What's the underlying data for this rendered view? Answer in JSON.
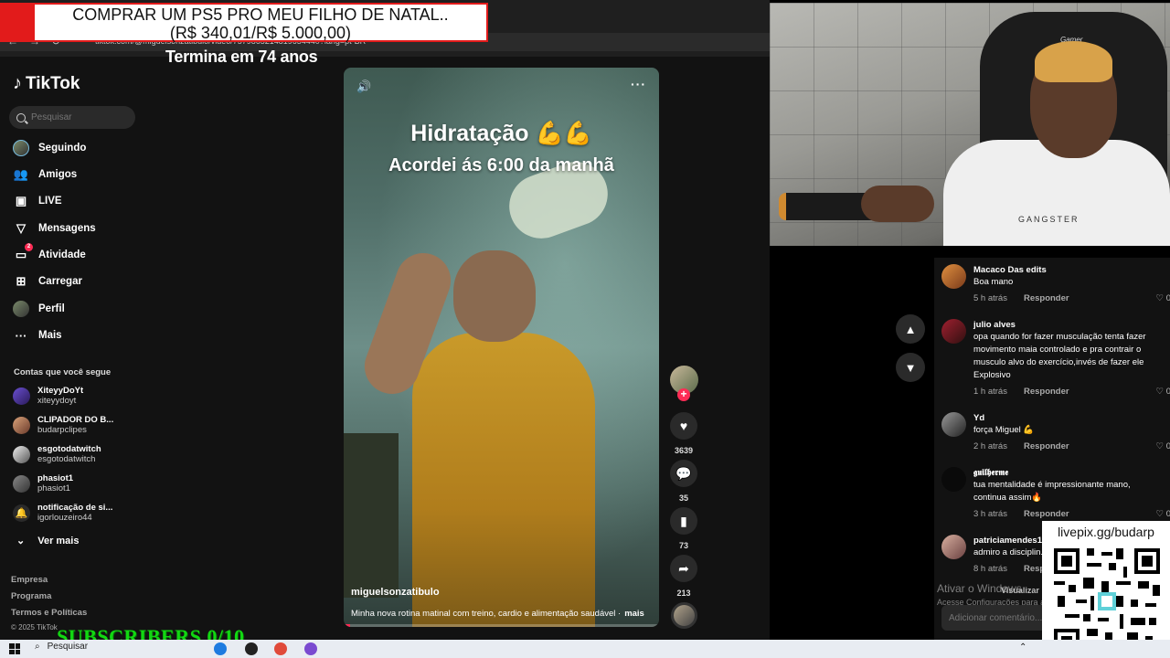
{
  "browser": {
    "url": "tiktok.com/@miguelsonzatibulo/video/7579865214819654440?lang=pt-BR"
  },
  "overlay": {
    "banner_line1": "COMPRAR UM PS5 PRO MEU FILHO DE NATAL..",
    "banner_line2": "(R$ 340,01/R$ 5.000,00)",
    "countdown": "Termina em 74 anos",
    "subscribers": "SUBSCRIBERS 0/10",
    "livepix": "livepix.gg/budarp"
  },
  "sidebar": {
    "logo": "TikTok",
    "search_placeholder": "Pesquisar",
    "nav": [
      {
        "label": "Seguindo",
        "icon": "following-avatar-icon"
      },
      {
        "label": "Amigos",
        "icon": "friends-icon"
      },
      {
        "label": "LIVE",
        "icon": "live-icon"
      },
      {
        "label": "Mensagens",
        "icon": "messages-icon"
      },
      {
        "label": "Atividade",
        "icon": "activity-icon",
        "badge": "2"
      },
      {
        "label": "Carregar",
        "icon": "upload-icon"
      },
      {
        "label": "Perfil",
        "icon": "profile-avatar-icon"
      },
      {
        "label": "Mais",
        "icon": "more-icon"
      }
    ],
    "following_title": "Contas que você segue",
    "accounts": [
      {
        "name": "XiteyyDoYt",
        "handle": "xiteyydoyt"
      },
      {
        "name": "CLIPADOR DO B...",
        "handle": "budarpclipes"
      },
      {
        "name": "esgotodatwitch",
        "handle": "esgotodatwitch"
      },
      {
        "name": "phasiot1",
        "handle": "phasiot1"
      },
      {
        "name": "notificação de si...",
        "handle": "igorlouzeiro44"
      }
    ],
    "see_more": "Ver mais",
    "footer": [
      "Empresa",
      "Programa",
      "Termos e Políticas",
      "© 2025 TikTok"
    ]
  },
  "video": {
    "caption_title": "Hidratação 💪💪",
    "caption_sub": "Acordei ás 6:00 da manhã",
    "author": "miguelsonzatibulo",
    "description": "Minha nova rotina matinal com treino, cardio e alimentação saudável ·",
    "more": "mais",
    "progress": 0.02,
    "likes": "3639",
    "comments": "35",
    "saves": "73",
    "shares": "213"
  },
  "comments": [
    {
      "name": "Macaco Das edits",
      "text": "Boa mano",
      "time": "5 h atrás",
      "reply": "Responder",
      "likes": "0"
    },
    {
      "name": "julio alves",
      "text": "opa quando for fazer musculação tenta fazer movimento maia controlado e pra contrair o musculo alvo do exercício,invés de fazer ele Explosivo",
      "time": "1 h atrás",
      "reply": "Responder",
      "likes": "0"
    },
    {
      "name": "Yd",
      "text": "força Miguel 💪",
      "time": "2 h atrás",
      "reply": "Responder",
      "likes": "0"
    },
    {
      "name": "𝖌𝖚𝖎𝖑𝖍𝖊𝖗𝖒𝖊",
      "text": "tua mentalidade é impressionante mano, continua assim🔥",
      "time": "3 h atrás",
      "reply": "Responder",
      "likes": "0"
    },
    {
      "name": "patriciamendes1...",
      "text": "admiro a disciplin...",
      "time": "8 h atrás",
      "reply": "Resp...",
      "likes": "0"
    }
  ],
  "comment_input_placeholder": "Adicionar comentário...",
  "windows_activate": {
    "title": "Ativar o Windows",
    "sub": "Acesse Configurações para ativar o Windows.",
    "view": "Visualizar"
  },
  "webcam": {
    "chair_brand": "Gamer",
    "shirt_text": "GANGSTER"
  },
  "taskbar": {
    "search": "Pesquisar"
  },
  "colors": {
    "accent": "#fe2c55",
    "background": "#121212",
    "subscribers": "#12d812"
  }
}
